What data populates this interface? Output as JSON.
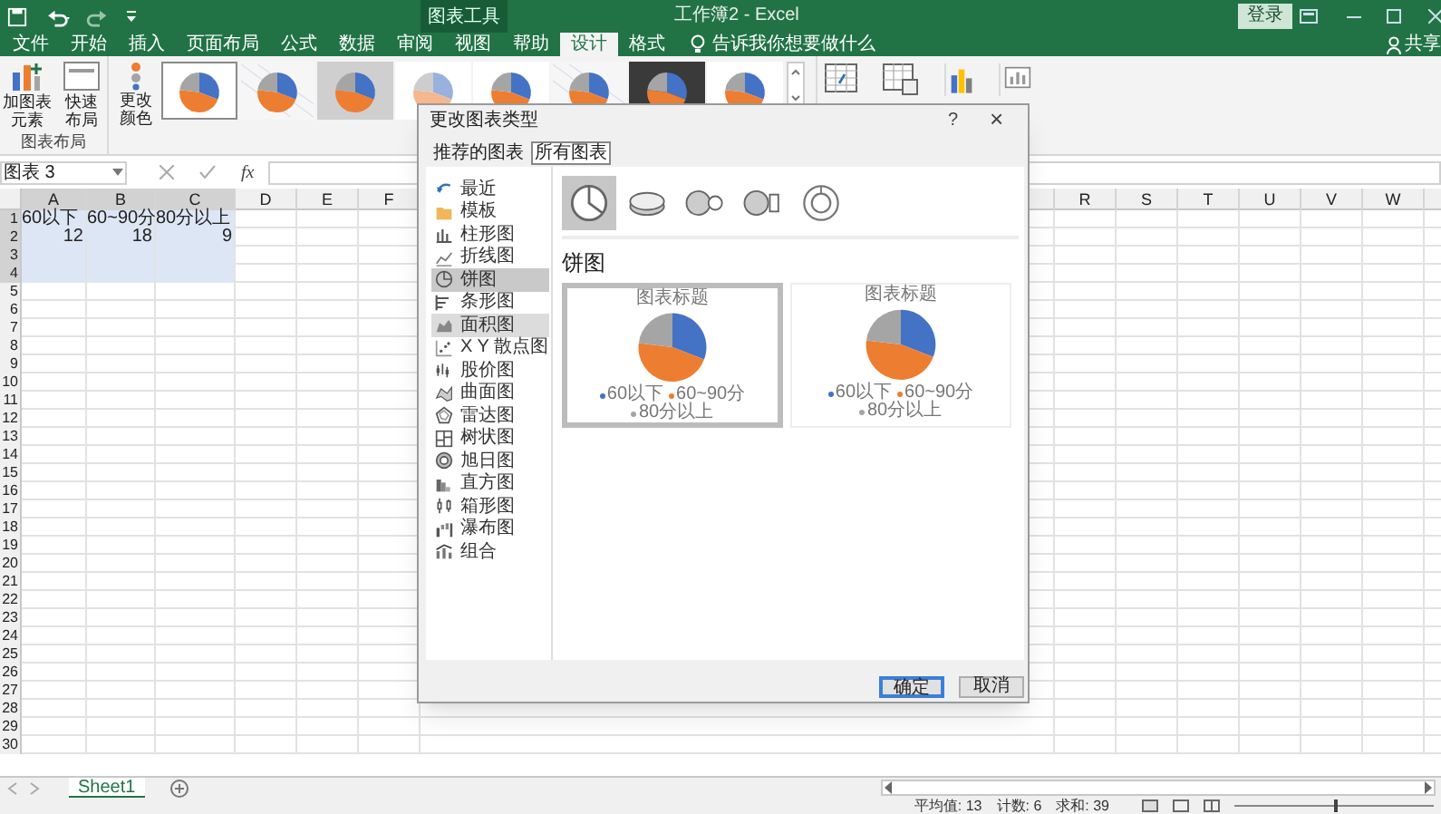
{
  "title_bar": {
    "context_group": "图表工具",
    "title": "工作簿2 - Excel",
    "sign_in": "登录"
  },
  "ribbon_tabs": [
    {
      "label": "文件",
      "selected": false
    },
    {
      "label": "开始",
      "selected": false
    },
    {
      "label": "插入",
      "selected": false
    },
    {
      "label": "页面布局",
      "selected": false
    },
    {
      "label": "公式",
      "selected": false
    },
    {
      "label": "数据",
      "selected": false
    },
    {
      "label": "审阅",
      "selected": false
    },
    {
      "label": "视图",
      "selected": false
    },
    {
      "label": "帮助",
      "selected": false
    },
    {
      "label": "设计",
      "selected": true
    },
    {
      "label": "格式",
      "selected": false
    }
  ],
  "tell_me": "告诉我你想要做什么",
  "share": "共享",
  "ribbon": {
    "add_element": "加图表元素",
    "quick_layout": "快速布局",
    "group_label": "图表布局",
    "change_colors": "更改颜色",
    "styles": [
      {
        "kind": "light",
        "selected": true
      },
      {
        "kind": "pattern",
        "selected": false
      },
      {
        "kind": "gray",
        "selected": false
      },
      {
        "kind": "faded",
        "selected": false
      },
      {
        "kind": "light",
        "selected": false
      },
      {
        "kind": "pattern",
        "selected": false
      },
      {
        "kind": "dark",
        "selected": false
      },
      {
        "kind": "light",
        "selected": false
      }
    ]
  },
  "formula_bar": {
    "name_box": "图表 3",
    "function_label": "fx"
  },
  "sheet": {
    "columns_left": [
      {
        "label": "A",
        "selected": true
      },
      {
        "label": "B",
        "selected": true
      },
      {
        "label": "C",
        "selected": true
      },
      {
        "label": "D",
        "selected": false
      },
      {
        "label": "E",
        "selected": false
      },
      {
        "label": "F",
        "selected": false
      }
    ],
    "columns_right": [
      "R",
      "S",
      "T",
      "U",
      "V",
      "W"
    ],
    "rows": [
      {
        "label": "1",
        "selected": true,
        "cells": [
          {
            "text": "60以下",
            "kind": "text"
          },
          {
            "text": "60~90分",
            "kind": "text"
          },
          {
            "text": "80分以上",
            "kind": "text"
          }
        ]
      },
      {
        "label": "2",
        "selected": true,
        "cells": [
          {
            "text": "12",
            "kind": "number"
          },
          {
            "text": "18",
            "kind": "number"
          },
          {
            "text": "9",
            "kind": "number"
          }
        ]
      },
      {
        "label": "3",
        "selected": true
      },
      {
        "label": "4",
        "selected": true
      },
      {
        "label": "5",
        "selected": false
      },
      {
        "label": "6",
        "selected": false
      },
      {
        "label": "7",
        "selected": false
      },
      {
        "label": "8",
        "selected": false
      },
      {
        "label": "9",
        "selected": false
      },
      {
        "label": "10",
        "selected": false
      },
      {
        "label": "11",
        "selected": false
      },
      {
        "label": "12",
        "selected": false
      },
      {
        "label": "13",
        "selected": false
      },
      {
        "label": "14",
        "selected": false
      },
      {
        "label": "15",
        "selected": false
      },
      {
        "label": "16",
        "selected": false
      },
      {
        "label": "17",
        "selected": false
      },
      {
        "label": "18",
        "selected": false
      },
      {
        "label": "19",
        "selected": false
      },
      {
        "label": "20",
        "selected": false
      },
      {
        "label": "21",
        "selected": false
      },
      {
        "label": "22",
        "selected": false
      },
      {
        "label": "23",
        "selected": false
      },
      {
        "label": "24",
        "selected": false
      },
      {
        "label": "25",
        "selected": false
      },
      {
        "label": "26",
        "selected": false
      },
      {
        "label": "27",
        "selected": false
      },
      {
        "label": "28",
        "selected": false
      },
      {
        "label": "29",
        "selected": false
      },
      {
        "label": "30",
        "selected": false
      }
    ]
  },
  "sheet_tabs": [
    {
      "label": "Sheet1",
      "selected": true
    }
  ],
  "status_bar": {
    "stats": [
      "平均值: 13",
      "计数: 6",
      "求和: 39"
    ],
    "zoom": {
      "level": 0.5
    }
  },
  "dialog": {
    "title": "更改图表类型",
    "help": "?",
    "close": "×",
    "tabs": [
      {
        "label": "推荐的图表",
        "selected": false
      },
      {
        "label": "所有图表",
        "selected": true
      }
    ],
    "chart_types": [
      {
        "label": "最近",
        "selected": false,
        "hovered": false
      },
      {
        "label": "模板",
        "selected": false,
        "hovered": false
      },
      {
        "label": "柱形图",
        "selected": false,
        "hovered": false
      },
      {
        "label": "折线图",
        "selected": false,
        "hovered": false
      },
      {
        "label": "饼图",
        "selected": true,
        "hovered": false
      },
      {
        "label": "条形图",
        "selected": false,
        "hovered": false
      },
      {
        "label": "面积图",
        "selected": false,
        "hovered": true
      },
      {
        "label": "X Y 散点图",
        "selected": false,
        "hovered": false
      },
      {
        "label": "股价图",
        "selected": false,
        "hovered": false
      },
      {
        "label": "曲面图",
        "selected": false,
        "hovered": false
      },
      {
        "label": "雷达图",
        "selected": false,
        "hovered": false
      },
      {
        "label": "树状图",
        "selected": false,
        "hovered": false
      },
      {
        "label": "旭日图",
        "selected": false,
        "hovered": false
      },
      {
        "label": "直方图",
        "selected": false,
        "hovered": false
      },
      {
        "label": "箱形图",
        "selected": false,
        "hovered": false
      },
      {
        "label": "瀑布图",
        "selected": false,
        "hovered": false
      },
      {
        "label": "组合",
        "selected": false,
        "hovered": false
      }
    ],
    "subtypes": [
      {
        "selected": true
      },
      {
        "selected": false
      },
      {
        "selected": false
      },
      {
        "selected": false
      },
      {
        "selected": false
      }
    ],
    "heading": "饼图",
    "previews": [
      {
        "title": "图表标题",
        "legend": [
          "60以下",
          "60~90分",
          "80分以上"
        ],
        "selected": true
      },
      {
        "title": "图表标题",
        "legend": [
          "60以下",
          "60~90分",
          "80分以上"
        ],
        "selected": false
      }
    ],
    "buttons": [
      {
        "label": "确定",
        "default": true
      },
      {
        "label": "取消",
        "default": false
      }
    ]
  }
}
